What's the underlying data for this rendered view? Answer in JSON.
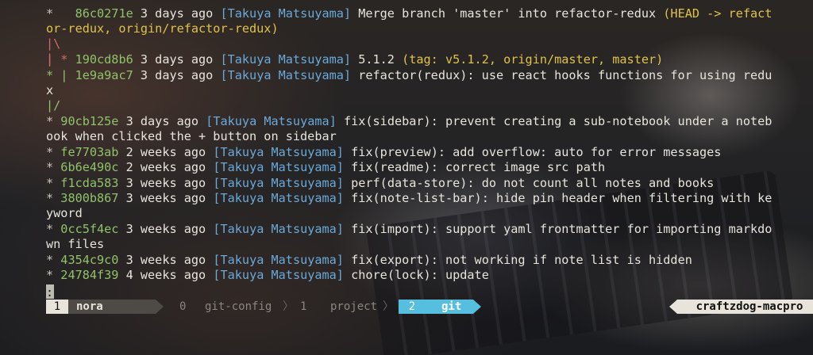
{
  "log": [
    {
      "graph": "*   ",
      "hash": "86c0271e",
      "time": "3 days ago",
      "author": "[Takuya Matsuyama]",
      "message": "Merge branch 'master' into refactor-redux",
      "refs": "(HEAD -> refact"
    },
    {
      "wrap": "or-redux, origin/refactor-redux)"
    },
    {
      "graph_only": "|\\"
    },
    {
      "graph_only": "|"
    },
    {
      "graph_prefix": "| * ",
      "hash": "190cd8b6",
      "time": "3 days ago",
      "author": "[Takuya Matsuyama]",
      "message": "5.1.2",
      "refs": "(tag: v5.1.2, origin/master, master)"
    },
    {
      "graph_prefix": "* | ",
      "hash": "1e9a9ac7",
      "time": "3 days ago",
      "author": "[Takuya Matsuyama]",
      "message": "refactor(redux): use react hooks functions for using redu"
    },
    {
      "wrap": "x"
    },
    {
      "graph_only": "|/"
    },
    {
      "graph_prefix": "* ",
      "hash": "90cb125e",
      "time": "3 days ago",
      "author": "[Takuya Matsuyama]",
      "message": "fix(sidebar): prevent creating a sub-notebook under a noteb"
    },
    {
      "wrap": "ook when clicked the + button on sidebar"
    },
    {
      "graph_prefix": "* ",
      "hash": "fe7703ab",
      "time": "2 weeks ago",
      "author": "[Takuya Matsuyama]",
      "message": "fix(preview): add overflow: auto for error messages"
    },
    {
      "graph_prefix": "* ",
      "hash": "6b6e490c",
      "time": "2 weeks ago",
      "author": "[Takuya Matsuyama]",
      "message": "fix(readme): correct image src path"
    },
    {
      "graph_prefix": "* ",
      "hash": "f1cda583",
      "time": "3 weeks ago",
      "author": "[Takuya Matsuyama]",
      "message": "perf(data-store): do not count all notes and books"
    },
    {
      "graph_prefix": "* ",
      "hash": "3800b867",
      "time": "3 weeks ago",
      "author": "[Takuya Matsuyama]",
      "message": "fix(note-list-bar): hide pin header when filtering with ke"
    },
    {
      "wrap": "yword"
    },
    {
      "graph_prefix": "* ",
      "hash": "0cc5f4ec",
      "time": "3 weeks ago",
      "author": "[Takuya Matsuyama]",
      "message": "fix(import): support yaml frontmatter for importing markdo"
    },
    {
      "wrap": "wn files"
    },
    {
      "graph_prefix": "* ",
      "hash": "4354c9c0",
      "time": "3 weeks ago",
      "author": "[Takuya Matsuyama]",
      "message": "fix(export): not working if note list is hidden"
    },
    {
      "graph_prefix": "* ",
      "hash": "24784f39",
      "time": "4 weeks ago",
      "author": "[Takuya Matsuyama]",
      "message": "chore(lock): update"
    }
  ],
  "pager_prompt": ":",
  "statusbar": {
    "windows": [
      {
        "index": "1",
        "name": "nora",
        "active": false,
        "current": true
      },
      {
        "index": "0",
        "name": "git-config",
        "active": false
      },
      {
        "index": "1",
        "name": "project",
        "active": false
      },
      {
        "index": "2",
        "name": "git",
        "active": true
      }
    ],
    "separator": "〉",
    "hostname": "craftzdog-macpro"
  },
  "colors": {
    "hash": "#8fc26a",
    "author": "#6aa9d8",
    "refs": "#e0c24b",
    "active_window": "#56bfe0",
    "graph_red": "#d06a6a"
  }
}
